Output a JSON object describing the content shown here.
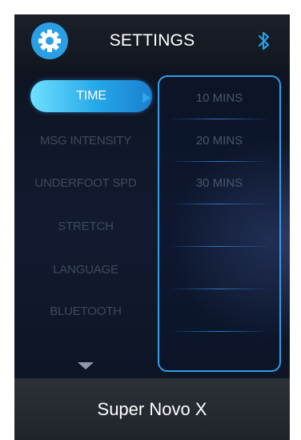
{
  "header": {
    "title": "SETTINGS",
    "settings_icon": "gear-icon",
    "bluetooth_icon": "bluetooth-icon",
    "accent_color": "#2a9fe6"
  },
  "menu": {
    "items": [
      {
        "label": "TIME",
        "active": true
      },
      {
        "label": "MSG INTENSITY",
        "active": false
      },
      {
        "label": "UNDERFOOT SPD",
        "active": false
      },
      {
        "label": "STRETCH",
        "active": false
      },
      {
        "label": "LANGUAGE",
        "active": false
      },
      {
        "label": "BLUETOOTH",
        "active": false
      }
    ],
    "scroll_icon": "down-arrow-icon"
  },
  "options": {
    "items": [
      {
        "label": "10 MINS"
      },
      {
        "label": "20 MINS"
      },
      {
        "label": "30 MINS"
      }
    ]
  },
  "footer": {
    "model_name": "Super Novo X"
  }
}
